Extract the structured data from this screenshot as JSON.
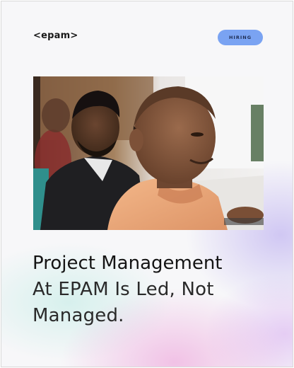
{
  "brand": {
    "logo_text": "<epam>"
  },
  "badge": {
    "label": "HIRING",
    "color": "#7aa3f2"
  },
  "photo": {
    "alt": "Two colleagues working at a desk",
    "icon": "photo"
  },
  "headline": {
    "line1": "Project Management",
    "line2": "At EPAM Is Led, Not",
    "line3": "Managed."
  },
  "colors": {
    "wash_lavender": "#b0a0ee",
    "wash_pink": "#ec96d6",
    "wash_mint": "#afe8de",
    "text": "#141414"
  }
}
